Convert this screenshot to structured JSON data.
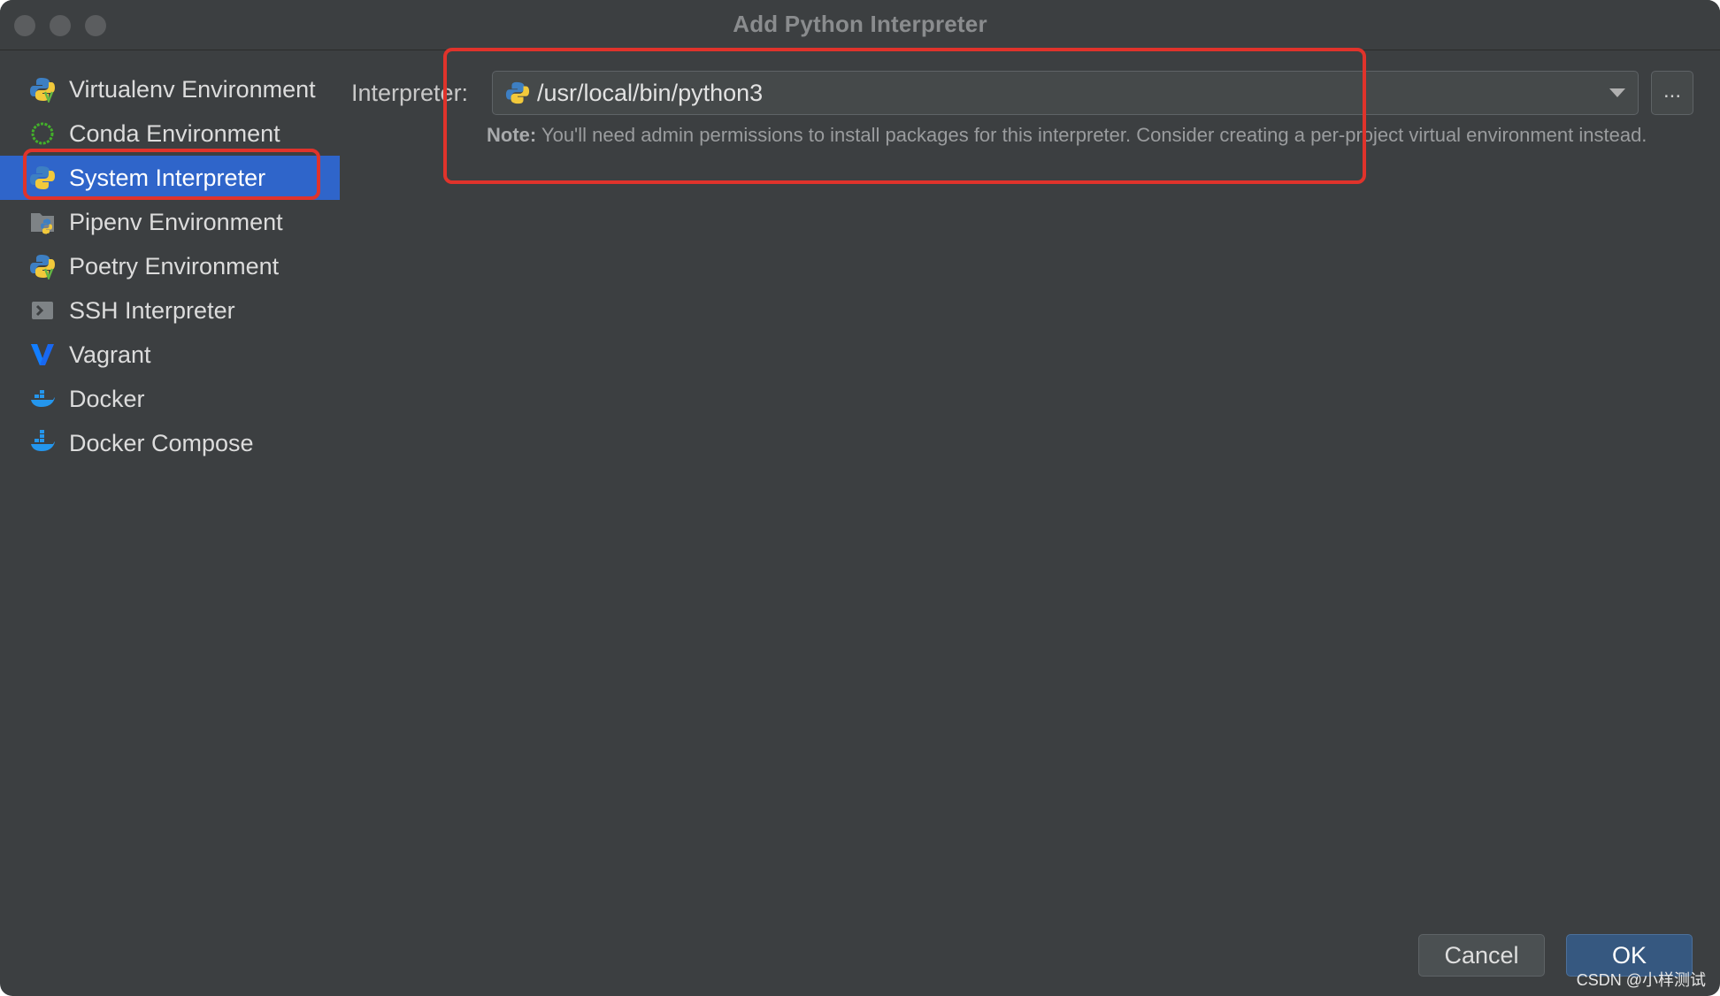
{
  "window": {
    "title": "Add Python Interpreter"
  },
  "sidebar": {
    "items": [
      {
        "label": "Virtualenv Environment",
        "icon": "python-virtualenv-icon"
      },
      {
        "label": "Conda Environment",
        "icon": "conda-icon"
      },
      {
        "label": "System Interpreter",
        "icon": "python-icon",
        "selected": true
      },
      {
        "label": "Pipenv Environment",
        "icon": "pipenv-icon"
      },
      {
        "label": "Poetry Environment",
        "icon": "poetry-icon"
      },
      {
        "label": "SSH Interpreter",
        "icon": "ssh-terminal-icon"
      },
      {
        "label": "Vagrant",
        "icon": "vagrant-icon"
      },
      {
        "label": "Docker",
        "icon": "docker-icon"
      },
      {
        "label": "Docker Compose",
        "icon": "docker-compose-icon"
      }
    ]
  },
  "main": {
    "interpreter_label": "Interpreter:",
    "interpreter_value": "/usr/local/bin/python3",
    "browse_label": "...",
    "note_bold": "Note:",
    "note_text": " You'll need admin permissions to install packages for this interpreter. Consider creating a per-project virtual environment instead."
  },
  "footer": {
    "cancel_label": "Cancel",
    "ok_label": "OK"
  },
  "watermark": "CSDN @小样测试",
  "colors": {
    "background": "#3c3f41",
    "selection": "#2f65ca",
    "highlight_box": "#e0332b",
    "ok_button": "#365880"
  }
}
